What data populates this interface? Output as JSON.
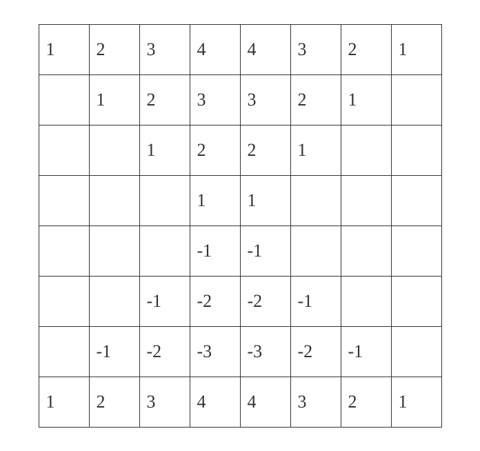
{
  "grid": {
    "rows": [
      [
        "1",
        "2",
        "3",
        "4",
        "4",
        "3",
        "2",
        "1"
      ],
      [
        "",
        "1",
        "2",
        "3",
        "3",
        "2",
        "1",
        ""
      ],
      [
        "",
        "",
        "1",
        "2",
        "2",
        "1",
        "",
        ""
      ],
      [
        "",
        "",
        "",
        "1",
        "1",
        "",
        "",
        ""
      ],
      [
        "",
        "",
        "",
        "-1",
        "-1",
        "",
        "",
        ""
      ],
      [
        "",
        "",
        "-1",
        "-2",
        "-2",
        "-1",
        "",
        ""
      ],
      [
        "",
        "-1",
        "-2",
        "-3",
        "-3",
        "-2",
        "-1",
        ""
      ],
      [
        "1",
        "2",
        "3",
        "4",
        "4",
        "3",
        "2",
        "1"
      ]
    ]
  }
}
